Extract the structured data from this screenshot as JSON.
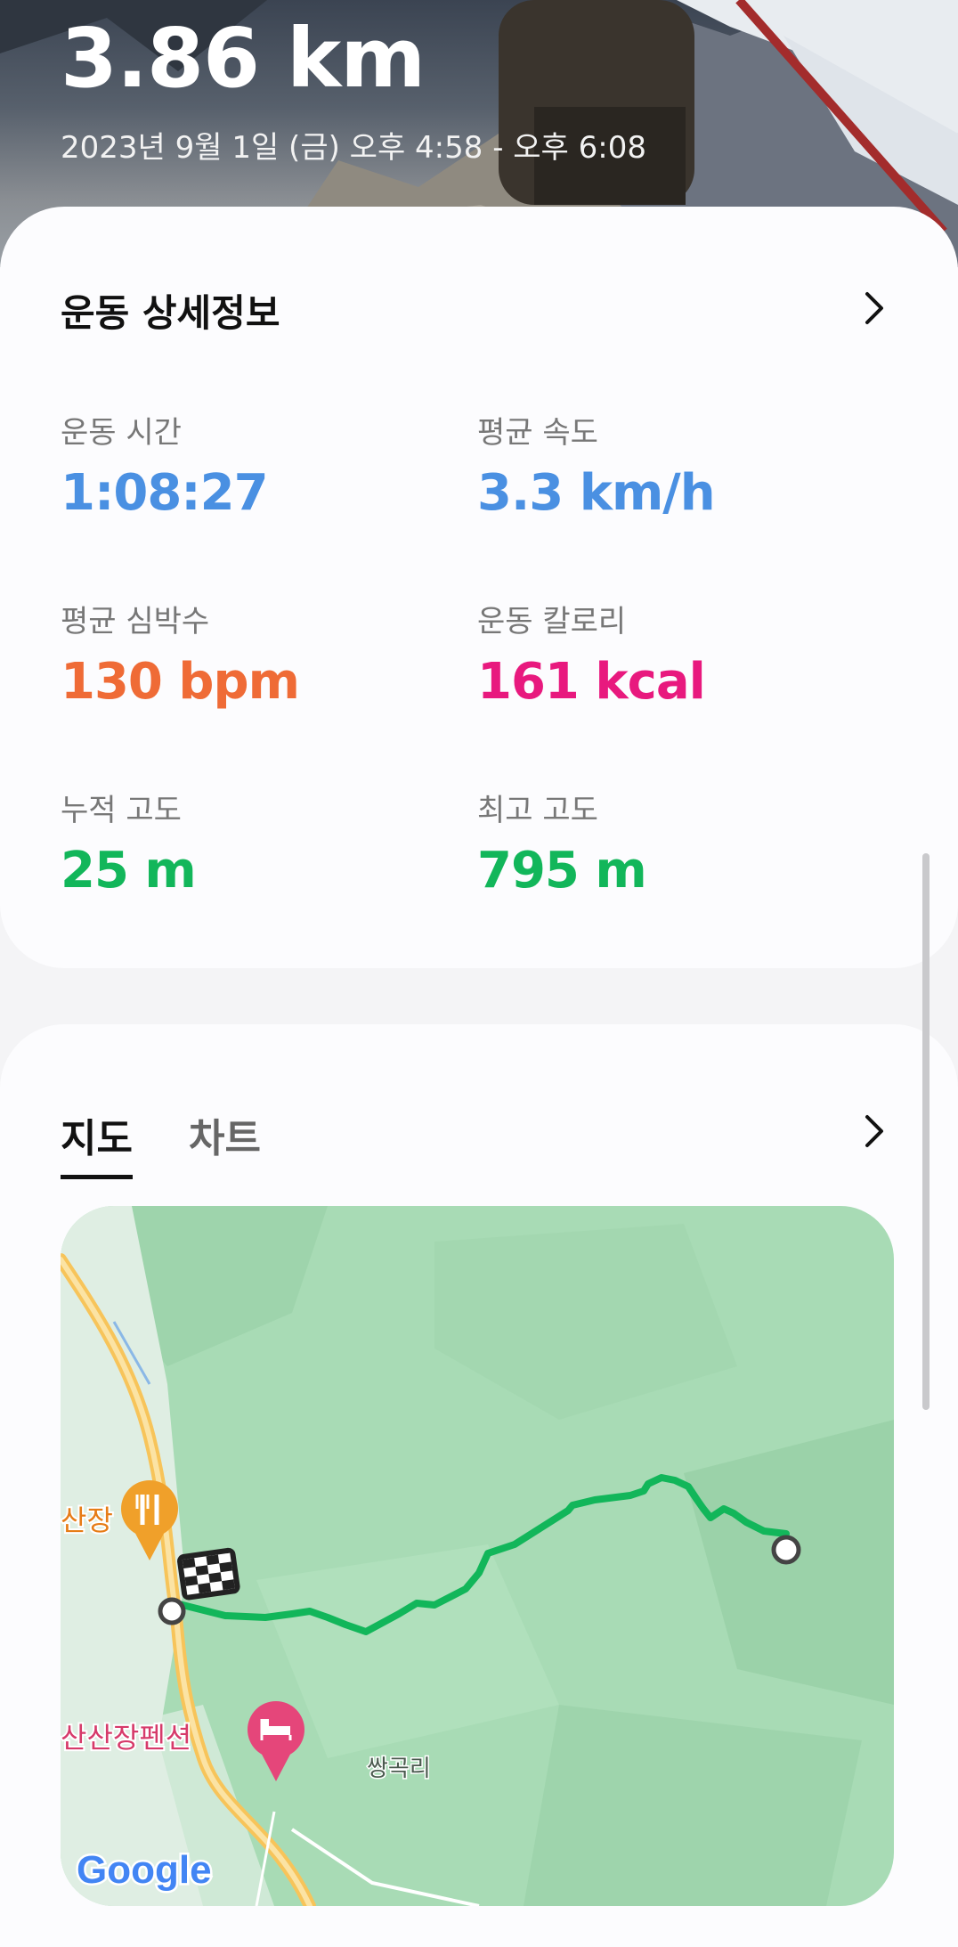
{
  "header": {
    "distance": "3.86 km",
    "date_range": "2023년 9월 1일 (금) 오후 4:58 - 오후 6:08"
  },
  "details": {
    "title": "운동 상세정보",
    "metrics": [
      {
        "label": "운동 시간",
        "value": "1:08:27",
        "color": "#4a90e2"
      },
      {
        "label": "평균 속도",
        "value": "3.3 km/h",
        "color": "#4a90e2"
      },
      {
        "label": "평균 심박수",
        "value": "130 bpm",
        "color": "#ef6b36"
      },
      {
        "label": "운동 칼로리",
        "value": "161 kcal",
        "color": "#e8197e"
      },
      {
        "label": "누적 고도",
        "value": "25 m",
        "color": "#12b65a"
      },
      {
        "label": "최고 고도",
        "value": "795 m",
        "color": "#12b65a"
      }
    ]
  },
  "map_section": {
    "tabs": [
      "지도",
      "차트"
    ],
    "active_tab": "지도",
    "map_labels": {
      "restaurant": "산장",
      "lodging": "산산장펜션",
      "village": "쌍곡리",
      "logo": "Google"
    },
    "route_color": "#12b65a"
  },
  "icons": {
    "chevron": "chevron-right-icon",
    "finish": "checkered-flag-icon",
    "restaurant": "fork-knife-icon",
    "lodging": "bed-icon"
  }
}
